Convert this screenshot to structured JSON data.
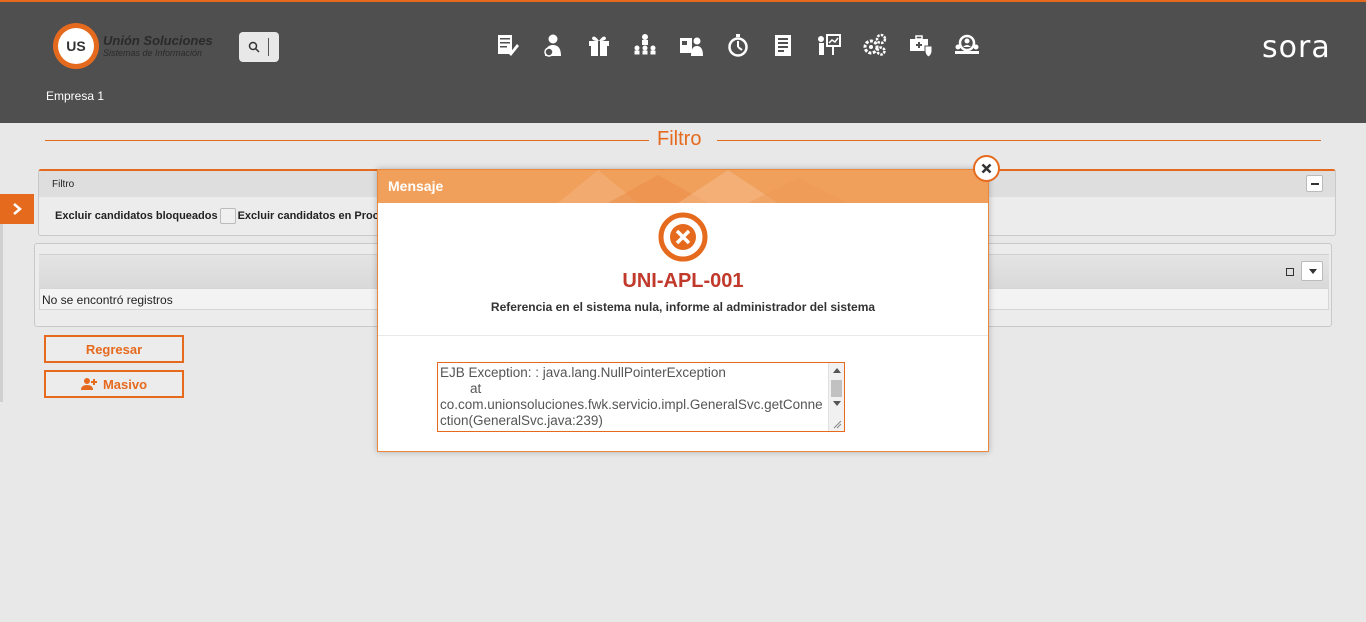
{
  "header": {
    "logo_name": "Unión Soluciones",
    "logo_sub": "Sistemas de Información",
    "logo_badge": "US",
    "brand": "sora",
    "company": "Empresa 1",
    "nav_icons": [
      "contract-edit-icon",
      "person-money-icon",
      "gift-icon",
      "org-chart-icon",
      "id-card-person-icon",
      "stopwatch-icon",
      "document-icon",
      "training-board-icon",
      "gears-icon",
      "medical-case-icon",
      "people-search-icon"
    ]
  },
  "section": {
    "title": "Filtro"
  },
  "filter": {
    "panel_title": "Filtro",
    "exclude_blocked_label": "Excluir candidatos bloqueados",
    "exclude_process_label": "Excluir candidatos en Proc"
  },
  "grid": {
    "empty_message": "No se encontró registros"
  },
  "buttons": {
    "back_label": "Regresar",
    "bulk_label": "Masivo"
  },
  "modal": {
    "title": "Mensaje",
    "code": "UNI-APL-001",
    "message": "Referencia en el sistema nula, informe al administrador del sistema",
    "detail": "EJB Exception: : java.lang.NullPointerException\n        at\nco.com.unionsoluciones.fwk.servicio.impl.GeneralSvc.getConnection(GeneralSvc.java:239)"
  },
  "colors": {
    "accent": "#e66a1e",
    "header_bg": "#4f4f4f",
    "error": "#c0392b",
    "modal_header": "#f1a05c"
  }
}
